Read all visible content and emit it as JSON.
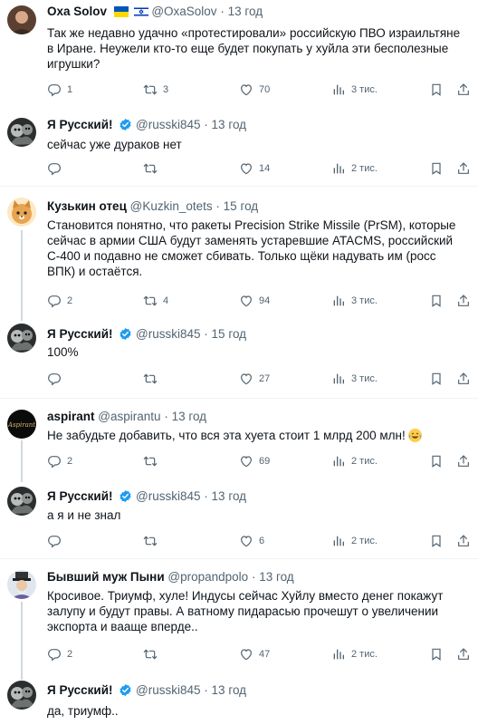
{
  "tweets": [
    {
      "name": "Oxa Solov",
      "handle": "@OxaSolov",
      "time": "13 год",
      "text": "Так же недавно удачно «протестировали» российскую ПВО израильтяне в Иране. Неужели кто-то еще будет покупать у хуйла эти бесполезные игрушки?",
      "replies": "1",
      "retweets": "3",
      "likes": "70",
      "views": "3 тис."
    },
    {
      "name": "Я Русский!",
      "handle": "@russki845",
      "time": "13 год",
      "text": "сейчас уже дураков нет",
      "replies": "",
      "retweets": "",
      "likes": "14",
      "views": "2 тис."
    },
    {
      "name": "Кузькин отец",
      "handle": "@Kuzkin_otets",
      "time": "15 год",
      "text": "Становится понятно, что ракеты Precision Strike Missile (PrSM), которые сейчас в армии США будут заменять устаревшие ATACMS, российский С-400  и подавно не сможет сбивать. Только щёки надувать им (росс ВПК) и остаётся.",
      "replies": "2",
      "retweets": "4",
      "likes": "94",
      "views": "3 тис."
    },
    {
      "name": "Я Русский!",
      "handle": "@russki845",
      "time": "15 год",
      "text": "100%",
      "replies": "",
      "retweets": "",
      "likes": "27",
      "views": "3 тис."
    },
    {
      "name": "aspirant",
      "handle": "@aspirantu",
      "time": "13 год",
      "text": "Не забудьте добавить, что вся эта хуета стоит 1 млрд 200 млн!",
      "replies": "2",
      "retweets": "",
      "likes": "69",
      "views": "2 тис."
    },
    {
      "name": "Я Русский!",
      "handle": "@russki845",
      "time": "13 год",
      "text": "а я и не знал",
      "replies": "",
      "retweets": "",
      "likes": "6",
      "views": "2 тис."
    },
    {
      "name": "Бывший муж Пыни",
      "handle": "@propandpolo",
      "time": "13 год",
      "text": "Кросивое. Триумф, хуле! Индусы сейчас Хуйлу вместо денег покажут залупу и будут правы. А ватному пидарасью прочешут о увеличении экспорта и вааще вперде..",
      "replies": "2",
      "retweets": "",
      "likes": "47",
      "views": "2 тис."
    },
    {
      "name": "Я Русский!",
      "handle": "@russki845",
      "time": "13 год",
      "text": "да, триумф..",
      "replies": "",
      "retweets": "",
      "likes": "",
      "views": ""
    }
  ],
  "aspirant_avatar_text": "Aspirant",
  "dot": "·",
  "colors": {
    "verified": "#1d9bf0",
    "muted": "#536471",
    "divider": "#eff3f4",
    "thread_line": "#cfd9de"
  },
  "icons": [
    "reply-icon",
    "retweet-icon",
    "like-icon",
    "views-icon",
    "bookmark-icon",
    "share-icon",
    "verified-badge-icon",
    "israel-flag-icon",
    "ukraine-flag-icon",
    "laughing-emoji-icon"
  ]
}
